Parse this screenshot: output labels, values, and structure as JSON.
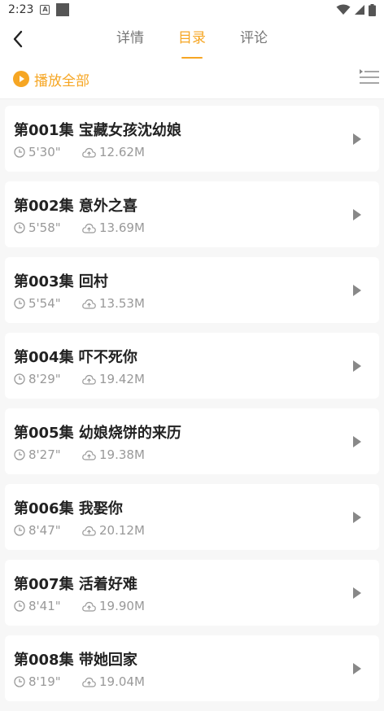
{
  "status_bar": {
    "time": "2:23"
  },
  "header": {
    "tabs": [
      {
        "label": "详情"
      },
      {
        "label": "目录"
      },
      {
        "label": "评论"
      }
    ],
    "active_tab": 1
  },
  "actions": {
    "play_all_label": "播放全部"
  },
  "colors": {
    "accent": "#f6a623",
    "muted": "#999999",
    "title": "#222222"
  },
  "episodes": [
    {
      "title": "第001集 宝藏女孩沈幼娘",
      "duration": "5'30\"",
      "size": "12.62M"
    },
    {
      "title": "第002集 意外之喜",
      "duration": "5'58\"",
      "size": "13.69M"
    },
    {
      "title": "第003集 回村",
      "duration": "5'54\"",
      "size": "13.53M"
    },
    {
      "title": "第004集 吓不死你",
      "duration": "8'29\"",
      "size": "19.42M"
    },
    {
      "title": "第005集 幼娘烧饼的来历",
      "duration": "8'27\"",
      "size": "19.38M"
    },
    {
      "title": "第006集 我娶你",
      "duration": "8'47\"",
      "size": "20.12M"
    },
    {
      "title": "第007集 活着好难",
      "duration": "8'41\"",
      "size": "19.90M"
    },
    {
      "title": "第008集 带她回家",
      "duration": "8'19\"",
      "size": "19.04M"
    }
  ]
}
